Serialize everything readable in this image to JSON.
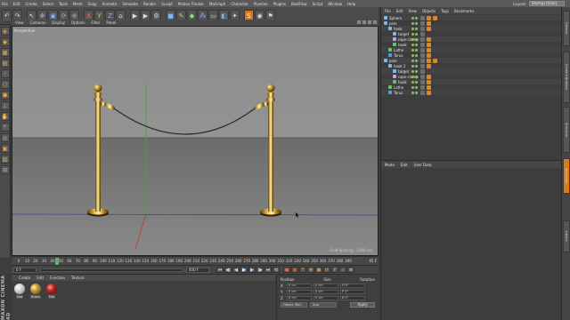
{
  "menubar": {
    "items": [
      "File",
      "Edit",
      "Create",
      "Select",
      "Tools",
      "Mesh",
      "Snap",
      "Animate",
      "Simulate",
      "Render",
      "Sculpt",
      "Motion Tracker",
      "MoGraph",
      "Character",
      "Pipeline",
      "Plugins",
      "RealFlow",
      "Script",
      "Window",
      "Help"
    ],
    "layout_label": "Layout:",
    "layout_value": "Startup (User)"
  },
  "viewport": {
    "menu": [
      "View",
      "Cameras",
      "Display",
      "Options",
      "Filter",
      "Panel"
    ],
    "camera_label": "Perspective",
    "grid_spacing": "Grid Spacing : 1000 cm"
  },
  "timeline": {
    "ticks": [
      "0",
      "10",
      "20",
      "30",
      "40",
      "50",
      "60",
      "70",
      "80",
      "90",
      "100",
      "110",
      "120",
      "130",
      "140",
      "150",
      "160",
      "170",
      "180",
      "190",
      "200",
      "210",
      "220",
      "230",
      "240",
      "250",
      "260",
      "270",
      "280",
      "290",
      "300",
      "310",
      "320",
      "330",
      "340",
      "350",
      "360",
      "370",
      "380",
      "390"
    ],
    "current_frame": "45 F",
    "frame_position": 0.115
  },
  "playbar": {
    "start": "0 F",
    "end": "400 F"
  },
  "materials": {
    "menu": [
      "Create",
      "Edit",
      "Function",
      "Texture"
    ],
    "items": [
      {
        "name": "Mat",
        "color_key": "white"
      },
      {
        "name": "Brass",
        "color_key": "brass"
      },
      {
        "name": "Mat",
        "color_key": "red"
      }
    ],
    "brand": "MAXON CINEMA 4D"
  },
  "coordinates": {
    "headers": [
      "Position",
      "Size",
      "Rotation"
    ],
    "rows": [
      {
        "axis": "X",
        "pos": "0 cm",
        "size": "0 cm",
        "rot": "H 0°"
      },
      {
        "axis": "Y",
        "pos": "0 cm",
        "size": "0 cm",
        "rot": "P 0°"
      },
      {
        "axis": "Z",
        "pos": "0 cm",
        "size": "0 cm",
        "rot": "B 0°"
      }
    ],
    "mode": "Object (Rel)",
    "size_mode": "Size",
    "apply": "Apply"
  },
  "objects": {
    "menu": [
      "File",
      "Edit",
      "View",
      "Objects",
      "Tags",
      "Bookmarks"
    ],
    "rows": [
      {
        "label": "Sphere",
        "indent": 0,
        "icon": "null",
        "tags": 2
      },
      {
        "label": "pole",
        "indent": 0,
        "icon": "null",
        "tags": 1
      },
      {
        "label": "hook",
        "indent": 1,
        "icon": "null",
        "tags": 1
      },
      {
        "label": "target",
        "indent": 2,
        "icon": "null",
        "tags": 0
      },
      {
        "label": "rope-clamp",
        "indent": 2,
        "icon": "spline",
        "tags": 1
      },
      {
        "label": "hook",
        "indent": 2,
        "icon": "green",
        "tags": 1
      },
      {
        "label": "Lathe",
        "indent": 1,
        "icon": "green",
        "tags": 1
      },
      {
        "label": "Torus",
        "indent": 1,
        "icon": "torus",
        "tags": 1
      },
      {
        "label": "pole",
        "indent": 0,
        "icon": "null",
        "tags": 2
      },
      {
        "label": "hook 2",
        "indent": 1,
        "icon": "null",
        "tags": 1
      },
      {
        "label": "target",
        "indent": 2,
        "icon": "null",
        "tags": 0
      },
      {
        "label": "rope-clamp",
        "indent": 2,
        "icon": "spline",
        "tags": 1
      },
      {
        "label": "hook",
        "indent": 2,
        "icon": "green",
        "tags": 1
      },
      {
        "label": "Lathe",
        "indent": 1,
        "icon": "green",
        "tags": 1
      },
      {
        "label": "Torus",
        "indent": 1,
        "icon": "torus",
        "tags": 1
      }
    ]
  },
  "attributes": {
    "menu": [
      "Mode",
      "Edit",
      "User Data"
    ]
  },
  "right_tabs": [
    "Objects",
    "Content Browser",
    "Structure",
    "Attributes",
    "Layers"
  ],
  "colors": {
    "accent_orange": "#d67a1c",
    "brass": "#c99a35",
    "active_blue": "#2f6fa8"
  }
}
